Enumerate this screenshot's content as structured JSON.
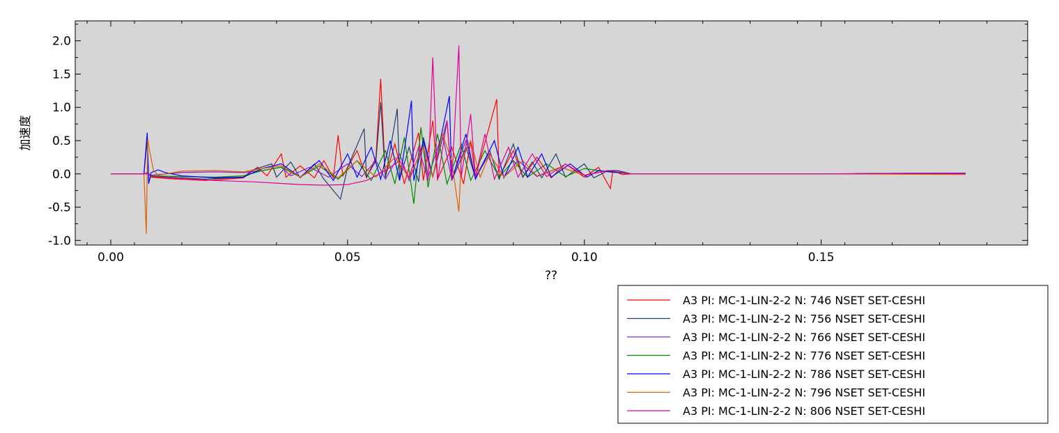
{
  "chart_data": {
    "type": "line",
    "xlabel": "??",
    "ylabel": "加速度",
    "xlim": [
      -0.0075,
      0.1936
    ],
    "ylim": [
      -1.07,
      2.3
    ],
    "x_ticks": [
      {
        "value": 0.0,
        "label": "0.00"
      },
      {
        "value": 0.05,
        "label": "0.05"
      },
      {
        "value": 0.1,
        "label": "0.10"
      },
      {
        "value": 0.15,
        "label": "0.15"
      }
    ],
    "y_ticks": [
      {
        "value": -1.0,
        "label": "-1.0"
      },
      {
        "value": -0.5,
        "label": "-0.5"
      },
      {
        "value": 0.0,
        "label": "0.0"
      },
      {
        "value": 0.5,
        "label": "0.5"
      },
      {
        "value": 1.0,
        "label": "1.0"
      },
      {
        "value": 1.5,
        "label": "1.5"
      },
      {
        "value": 2.0,
        "label": "2.0"
      }
    ],
    "grid": false,
    "plot_background": "#d6d6d6",
    "legend_placement": "bottom-right",
    "series": [
      {
        "name": "A3 PI: MC-1-LIN-2-2 N: 746 NSET SET-CESHI",
        "color": "#ff0000",
        "points": [
          [
            0,
            0
          ],
          [
            0.007,
            0
          ],
          [
            0.0078,
            0.02
          ],
          [
            0.0085,
            -0.05
          ],
          [
            0.012,
            -0.07
          ],
          [
            0.02,
            -0.1
          ],
          [
            0.028,
            -0.06
          ],
          [
            0.031,
            0.1
          ],
          [
            0.033,
            -0.03
          ],
          [
            0.036,
            0.3
          ],
          [
            0.037,
            -0.05
          ],
          [
            0.04,
            0.12
          ],
          [
            0.043,
            -0.06
          ],
          [
            0.045,
            0.2
          ],
          [
            0.047,
            -0.06
          ],
          [
            0.048,
            0.58
          ],
          [
            0.049,
            -0.03
          ],
          [
            0.052,
            0.35
          ],
          [
            0.054,
            -0.06
          ],
          [
            0.056,
            0.25
          ],
          [
            0.057,
            1.43
          ],
          [
            0.058,
            -0.04
          ],
          [
            0.06,
            0.45
          ],
          [
            0.062,
            -0.15
          ],
          [
            0.065,
            0.62
          ],
          [
            0.066,
            -0.1
          ],
          [
            0.068,
            0.8
          ],
          [
            0.069,
            -0.08
          ],
          [
            0.072,
            0.4
          ],
          [
            0.0745,
            -0.15
          ],
          [
            0.076,
            0.5
          ],
          [
            0.077,
            -0.05
          ],
          [
            0.0815,
            1.12
          ],
          [
            0.082,
            -0.05
          ],
          [
            0.085,
            0.35
          ],
          [
            0.087,
            -0.05
          ],
          [
            0.09,
            0.25
          ],
          [
            0.093,
            -0.06
          ],
          [
            0.096,
            0.15
          ],
          [
            0.1,
            -0.05
          ],
          [
            0.103,
            0.1
          ],
          [
            0.1055,
            -0.22
          ],
          [
            0.106,
            0.05
          ],
          [
            0.108,
            -0.01
          ],
          [
            0.11,
            0
          ],
          [
            0.15,
            0
          ],
          [
            0.17,
            0.01
          ],
          [
            0.1805,
            0.01
          ]
        ]
      },
      {
        "name": "A3 PI: MC-1-LIN-2-2 N: 756 NSET SET-CESHI",
        "color": "#1f3d6e",
        "points": [
          [
            0,
            0
          ],
          [
            0.007,
            0
          ],
          [
            0.0077,
            0.5
          ],
          [
            0.008,
            -0.12
          ],
          [
            0.0085,
            -0.03
          ],
          [
            0.012,
            -0.05
          ],
          [
            0.02,
            -0.08
          ],
          [
            0.028,
            -0.05
          ],
          [
            0.03,
            0.06
          ],
          [
            0.034,
            0.15
          ],
          [
            0.035,
            -0.05
          ],
          [
            0.038,
            0.18
          ],
          [
            0.04,
            -0.06
          ],
          [
            0.043,
            0.15
          ],
          [
            0.045,
            -0.08
          ],
          [
            0.0485,
            -0.38
          ],
          [
            0.05,
            0.1
          ],
          [
            0.0535,
            0.68
          ],
          [
            0.054,
            -0.05
          ],
          [
            0.056,
            0.2
          ],
          [
            0.057,
            1.08
          ],
          [
            0.058,
            -0.06
          ],
          [
            0.0605,
            0.98
          ],
          [
            0.061,
            -0.08
          ],
          [
            0.063,
            0.4
          ],
          [
            0.065,
            -0.12
          ],
          [
            0.066,
            0.55
          ],
          [
            0.068,
            -0.05
          ],
          [
            0.071,
            0.8
          ],
          [
            0.072,
            -0.1
          ],
          [
            0.075,
            0.4
          ],
          [
            0.077,
            -0.06
          ],
          [
            0.08,
            0.35
          ],
          [
            0.082,
            -0.08
          ],
          [
            0.085,
            0.45
          ],
          [
            0.087,
            -0.05
          ],
          [
            0.089,
            0.18
          ],
          [
            0.091,
            -0.06
          ],
          [
            0.094,
            0.3
          ],
          [
            0.096,
            -0.05
          ],
          [
            0.1,
            0.15
          ],
          [
            0.102,
            -0.06
          ],
          [
            0.105,
            0.05
          ],
          [
            0.107,
            0.05
          ],
          [
            0.11,
            0
          ],
          [
            0.15,
            0
          ],
          [
            0.17,
            0.01
          ],
          [
            0.1805,
            0.01
          ]
        ]
      },
      {
        "name": "A3 PI: MC-1-LIN-2-2 N: 766 NSET SET-CESHI",
        "color": "#8b1fd6",
        "points": [
          [
            0,
            0
          ],
          [
            0.007,
            0
          ],
          [
            0.0078,
            0
          ],
          [
            0.0085,
            -0.02
          ],
          [
            0.015,
            0.02
          ],
          [
            0.022,
            0.03
          ],
          [
            0.028,
            0.02
          ],
          [
            0.032,
            0.05
          ],
          [
            0.036,
            0.1
          ],
          [
            0.038,
            -0.03
          ],
          [
            0.042,
            0.1
          ],
          [
            0.046,
            -0.05
          ],
          [
            0.05,
            0.15
          ],
          [
            0.053,
            -0.04
          ],
          [
            0.056,
            0.2
          ],
          [
            0.058,
            -0.08
          ],
          [
            0.061,
            0.3
          ],
          [
            0.063,
            -0.1
          ],
          [
            0.066,
            0.45
          ],
          [
            0.067,
            -0.05
          ],
          [
            0.07,
            0.6
          ],
          [
            0.072,
            -0.08
          ],
          [
            0.075,
            0.5
          ],
          [
            0.077,
            -0.05
          ],
          [
            0.08,
            0.3
          ],
          [
            0.083,
            -0.05
          ],
          [
            0.086,
            0.2
          ],
          [
            0.09,
            -0.04
          ],
          [
            0.095,
            0.1
          ],
          [
            0.1,
            -0.02
          ],
          [
            0.105,
            0.05
          ],
          [
            0.11,
            0
          ],
          [
            0.15,
            0
          ],
          [
            0.1805,
            0
          ]
        ]
      },
      {
        "name": "A3 PI: MC-1-LIN-2-2 N: 776 NSET SET-CESHI",
        "color": "#008a00",
        "points": [
          [
            0,
            0
          ],
          [
            0.007,
            0
          ],
          [
            0.0078,
            0.02
          ],
          [
            0.0085,
            -0.03
          ],
          [
            0.015,
            -0.04
          ],
          [
            0.022,
            -0.05
          ],
          [
            0.028,
            -0.03
          ],
          [
            0.032,
            0.05
          ],
          [
            0.036,
            0.1
          ],
          [
            0.04,
            -0.05
          ],
          [
            0.044,
            0.12
          ],
          [
            0.048,
            -0.08
          ],
          [
            0.052,
            0.2
          ],
          [
            0.055,
            -0.1
          ],
          [
            0.058,
            0.35
          ],
          [
            0.06,
            -0.15
          ],
          [
            0.062,
            0.55
          ],
          [
            0.064,
            -0.45
          ],
          [
            0.0655,
            0.7
          ],
          [
            0.067,
            -0.2
          ],
          [
            0.069,
            0.6
          ],
          [
            0.071,
            -0.15
          ],
          [
            0.074,
            0.45
          ],
          [
            0.076,
            -0.1
          ],
          [
            0.079,
            0.35
          ],
          [
            0.082,
            -0.05
          ],
          [
            0.085,
            0.2
          ],
          [
            0.088,
            -0.05
          ],
          [
            0.092,
            0.15
          ],
          [
            0.096,
            -0.04
          ],
          [
            0.1,
            0.08
          ],
          [
            0.105,
            0.03
          ],
          [
            0.11,
            0
          ],
          [
            0.15,
            0
          ],
          [
            0.1805,
            0.01
          ]
        ]
      },
      {
        "name": "A3 PI: MC-1-LIN-2-2 N: 786 NSET SET-CESHI",
        "color": "#0000ff",
        "points": [
          [
            0,
            0
          ],
          [
            0.007,
            0
          ],
          [
            0.0077,
            0.62
          ],
          [
            0.008,
            -0.15
          ],
          [
            0.0085,
            0.02
          ],
          [
            0.01,
            0.06
          ],
          [
            0.0115,
            0.02
          ],
          [
            0.015,
            -0.03
          ],
          [
            0.022,
            -0.06
          ],
          [
            0.028,
            -0.05
          ],
          [
            0.032,
            0.08
          ],
          [
            0.036,
            0.15
          ],
          [
            0.04,
            -0.05
          ],
          [
            0.044,
            0.2
          ],
          [
            0.047,
            -0.1
          ],
          [
            0.05,
            0.3
          ],
          [
            0.052,
            -0.05
          ],
          [
            0.055,
            0.4
          ],
          [
            0.057,
            -0.08
          ],
          [
            0.059,
            0.5
          ],
          [
            0.061,
            -0.1
          ],
          [
            0.0625,
            0.6
          ],
          [
            0.0635,
            1.1
          ],
          [
            0.064,
            -0.1
          ],
          [
            0.066,
            0.5
          ],
          [
            0.068,
            -0.05
          ],
          [
            0.0715,
            1.17
          ],
          [
            0.072,
            -0.1
          ],
          [
            0.075,
            0.6
          ],
          [
            0.077,
            -0.08
          ],
          [
            0.081,
            0.5
          ],
          [
            0.083,
            -0.06
          ],
          [
            0.086,
            0.4
          ],
          [
            0.088,
            -0.05
          ],
          [
            0.091,
            0.3
          ],
          [
            0.093,
            -0.05
          ],
          [
            0.097,
            0.15
          ],
          [
            0.1005,
            -0.05
          ],
          [
            0.103,
            0.05
          ],
          [
            0.11,
            0
          ],
          [
            0.15,
            0
          ],
          [
            0.1805,
            0.01
          ]
        ]
      },
      {
        "name": "A3 PI: MC-1-LIN-2-2 N: 796 NSET SET-CESHI",
        "color": "#e06000",
        "points": [
          [
            0,
            0
          ],
          [
            0.007,
            0
          ],
          [
            0.0075,
            -0.9
          ],
          [
            0.0078,
            0.52
          ],
          [
            0.0082,
            0.35
          ],
          [
            0.009,
            0.05
          ],
          [
            0.01,
            -0.02
          ],
          [
            0.015,
            0.04
          ],
          [
            0.022,
            0.05
          ],
          [
            0.028,
            0.03
          ],
          [
            0.032,
            0.08
          ],
          [
            0.036,
            0.12
          ],
          [
            0.04,
            -0.05
          ],
          [
            0.044,
            0.15
          ],
          [
            0.048,
            -0.06
          ],
          [
            0.052,
            0.2
          ],
          [
            0.056,
            -0.05
          ],
          [
            0.06,
            0.25
          ],
          [
            0.063,
            -0.06
          ],
          [
            0.066,
            0.4
          ],
          [
            0.068,
            -0.05
          ],
          [
            0.07,
            0.6
          ],
          [
            0.072,
            0.2
          ],
          [
            0.0735,
            -0.57
          ],
          [
            0.074,
            0.2
          ],
          [
            0.076,
            0.5
          ],
          [
            0.078,
            -0.05
          ],
          [
            0.08,
            0.3
          ],
          [
            0.083,
            -0.05
          ],
          [
            0.087,
            0.2
          ],
          [
            0.09,
            -0.03
          ],
          [
            0.095,
            0.1
          ],
          [
            0.1,
            -0.02
          ],
          [
            0.105,
            0.05
          ],
          [
            0.11,
            0
          ],
          [
            0.15,
            0
          ],
          [
            0.1805,
            -0.01
          ]
        ]
      },
      {
        "name": "A3 PI: MC-1-LIN-2-2 N: 806 NSET SET-CESHI",
        "color": "#e0009a",
        "points": [
          [
            0,
            0
          ],
          [
            0.007,
            0
          ],
          [
            0.0078,
            0.01
          ],
          [
            0.0085,
            -0.04
          ],
          [
            0.015,
            -0.07
          ],
          [
            0.022,
            -0.1
          ],
          [
            0.03,
            -0.12
          ],
          [
            0.035,
            -0.14
          ],
          [
            0.04,
            -0.16
          ],
          [
            0.045,
            -0.17
          ],
          [
            0.05,
            -0.16
          ],
          [
            0.054,
            -0.1
          ],
          [
            0.058,
            0.05
          ],
          [
            0.061,
            0.2
          ],
          [
            0.063,
            -0.05
          ],
          [
            0.065,
            0.4
          ],
          [
            0.067,
            -0.1
          ],
          [
            0.068,
            1.75
          ],
          [
            0.069,
            -0.1
          ],
          [
            0.071,
            0.8
          ],
          [
            0.072,
            -0.1
          ],
          [
            0.0735,
            1.93
          ],
          [
            0.074,
            -0.05
          ],
          [
            0.076,
            0.9
          ],
          [
            0.077,
            -0.05
          ],
          [
            0.079,
            0.6
          ],
          [
            0.081,
            -0.08
          ],
          [
            0.084,
            0.4
          ],
          [
            0.086,
            -0.05
          ],
          [
            0.089,
            0.3
          ],
          [
            0.092,
            -0.04
          ],
          [
            0.096,
            0.15
          ],
          [
            0.1,
            -0.02
          ],
          [
            0.105,
            0.05
          ],
          [
            0.11,
            0
          ],
          [
            0.15,
            0
          ],
          [
            0.1805,
            0.01
          ]
        ]
      }
    ]
  }
}
